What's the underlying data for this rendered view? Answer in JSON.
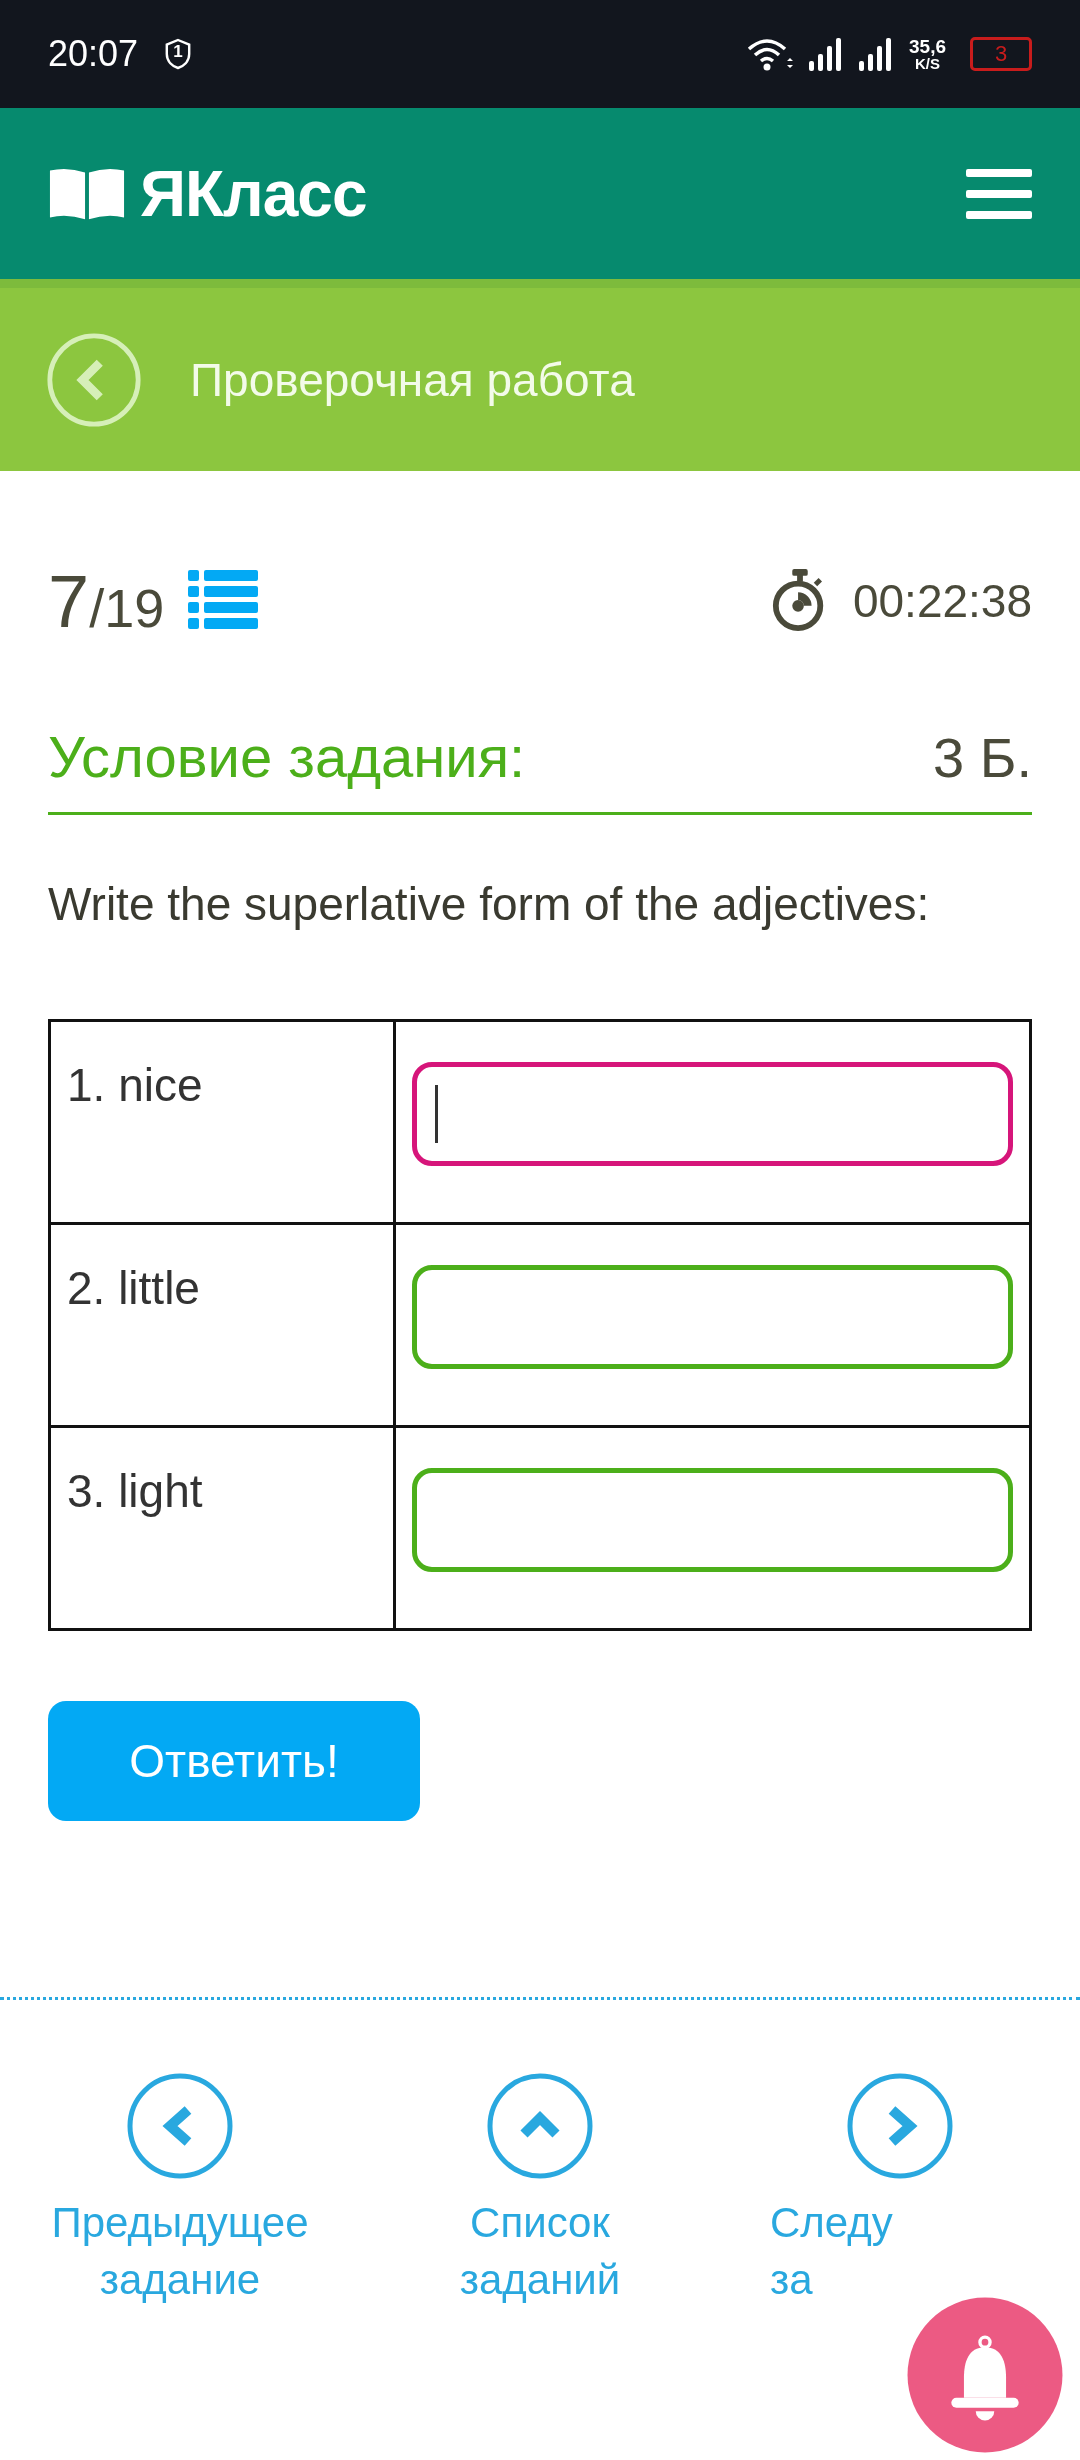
{
  "status_bar": {
    "time": "20:07",
    "shield_badge": "1",
    "net_speed": "35,6",
    "net_unit": "K/S",
    "battery": "3"
  },
  "header": {
    "logo": "ЯКласс"
  },
  "subheader": {
    "title": "Проверочная работа"
  },
  "progress": {
    "current": "7",
    "total": "/19",
    "timer": "00:22:38"
  },
  "task": {
    "heading": "Условие задания:",
    "points": "3 Б.",
    "prompt": "Write the superlative form of the adjectives:"
  },
  "rows": [
    {
      "label": "1. nice",
      "focused": true
    },
    {
      "label": "2. little",
      "focused": false
    },
    {
      "label": "3. light",
      "focused": false
    }
  ],
  "submit": "Ответить!",
  "nav": [
    {
      "kind": "prev",
      "lines": [
        "Предыдущее",
        "задание"
      ]
    },
    {
      "kind": "list",
      "lines": [
        "Список",
        "заданий"
      ]
    },
    {
      "kind": "next",
      "lines": [
        "Следу",
        "за"
      ]
    }
  ]
}
